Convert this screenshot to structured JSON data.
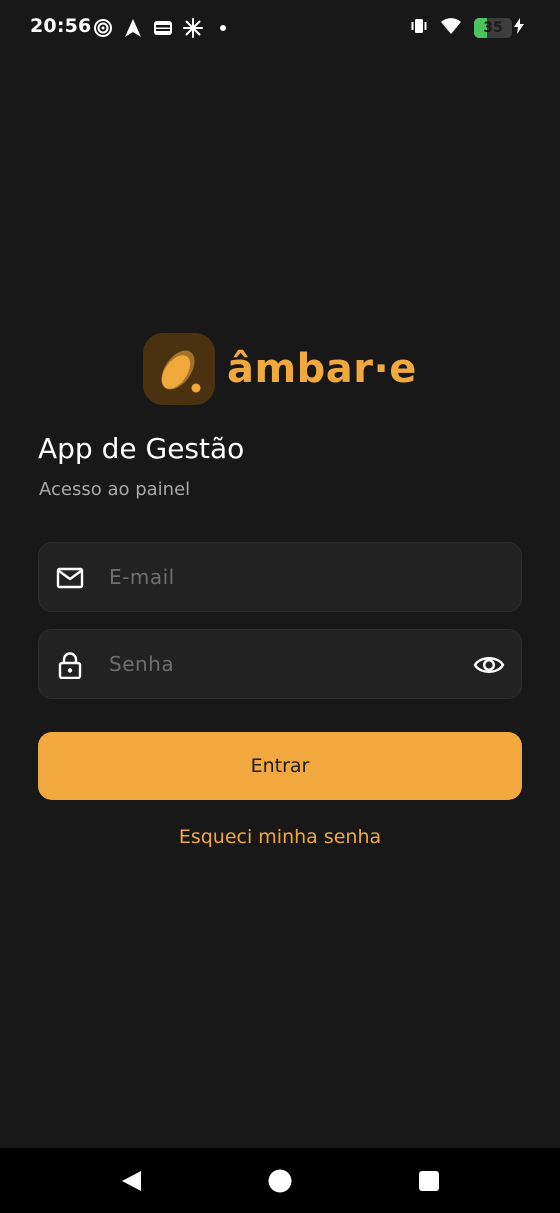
{
  "status_bar": {
    "time": "20:56",
    "battery_level": "35",
    "left_icons": [
      "hotspot-icon",
      "navigation-arrow-icon",
      "wallet-icon",
      "sparkle-icon",
      "dot-icon"
    ],
    "right_icons": [
      "vibrate-icon",
      "wifi-icon",
      "battery-icon",
      "charging-bolt-icon"
    ]
  },
  "brand": {
    "name": "âmbar·e",
    "accent_color": "#f0a93c",
    "logo_bg_color": "#4a3210"
  },
  "header": {
    "title": "App de Gestão",
    "subtitle": "Acesso ao painel"
  },
  "form": {
    "email": {
      "placeholder": "E-mail",
      "value": "",
      "icon": "mail-icon"
    },
    "password": {
      "placeholder": "Senha",
      "value": "",
      "icon": "lock-icon",
      "toggle_icon": "eye-icon"
    },
    "submit_label": "Entrar",
    "forgot_label": "Esqueci minha senha"
  },
  "nav_bar": {
    "buttons": [
      "back-triangle-icon",
      "home-circle-icon",
      "recents-square-icon"
    ]
  },
  "colors": {
    "background": "#181818",
    "field_bg": "#222222",
    "button_bg": "#f0a83f",
    "link": "#f0a83f"
  }
}
